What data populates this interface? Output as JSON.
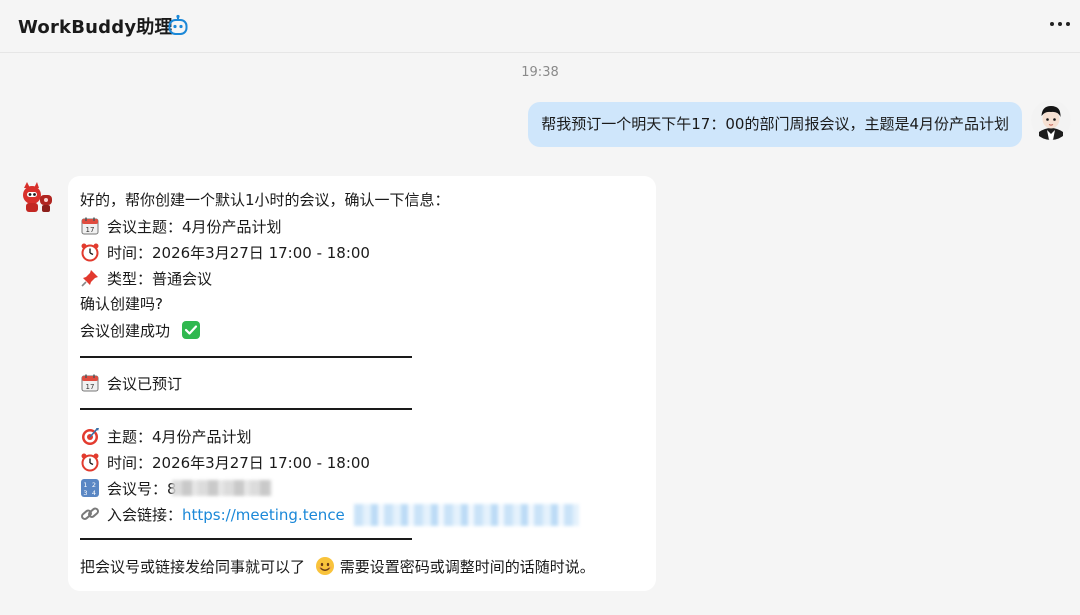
{
  "header": {
    "title": "WorkBuddy助理",
    "title_icon": "robot-icon",
    "more_icon": "more-icon"
  },
  "chat": {
    "timestamp": "19:38",
    "user_message": "帮我预订一个明天下午17：00的部门周报会议，主题是4月份产品计划",
    "bot_message": {
      "intro": "好的，帮你创建一个默认1小时的会议，确认一下信息：",
      "topic_line": "会议主题：4月份产品计划",
      "time_line": "时间：2026年3月27日 17:00 - 18:00",
      "type_line": "类型：普通会议",
      "confirm": "确认创建吗?",
      "success": "会议创建成功",
      "booked": "会议已预订",
      "subject_line": "主题：4月份产品计划",
      "time_line_2": "时间：2026年3月27日 17:00 - 18:00",
      "meeting_no_label": "会议号：",
      "meeting_no_visible": "8",
      "join_link_label": "入会链接：",
      "join_link_visible": "https://meeting.tence",
      "closing": "把会议号或链接发给同事就可以了",
      "closing_2": "需要设置密码或调整时间的话随时说。"
    }
  },
  "colors": {
    "user_bubble": "#cfe6fb",
    "bot_bubble": "#ffffff",
    "background": "#f5f5f5",
    "link": "#1b88d8",
    "success": "#2fb84f"
  },
  "icons": [
    "calendar-icon",
    "alarm-clock-icon",
    "pushpin-icon",
    "check-mark-icon",
    "dart-target-icon",
    "numbers-icon",
    "link-icon",
    "smile-emoji-icon"
  ]
}
